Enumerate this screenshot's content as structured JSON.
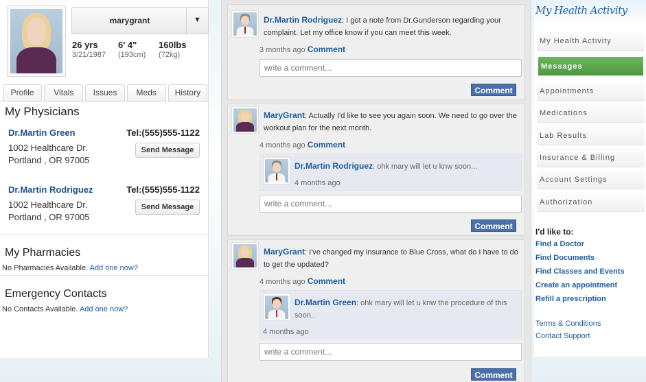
{
  "profile": {
    "username": "marygrant",
    "stats": [
      {
        "big": "26 yrs",
        "small": "3/21/1987"
      },
      {
        "big": "6' 4\"",
        "small": "(193cm)"
      },
      {
        "big": "160lbs",
        "small": "(72kg)"
      }
    ],
    "tabs": [
      "Profile",
      "Vitals",
      "Issues",
      "Meds",
      "History"
    ]
  },
  "physicians": {
    "title": "My Physicians",
    "items": [
      {
        "name": "Dr.Martin Green",
        "tel": "Tel:(555)555-1122",
        "addr1": "1002 Healthcare Dr.",
        "addr2": "Portland , OR 97005",
        "button": "Send Message"
      },
      {
        "name": "Dr.Martin Rodriguez",
        "tel": "Tel:(555)555-1122",
        "addr1": "1002 Healthcare Dr.",
        "addr2": "Portland , OR 97005",
        "button": "Send Message"
      }
    ]
  },
  "pharmacies": {
    "title": "My Pharmacies",
    "note": "No Pharmacies Available.",
    "link": "Add one now?"
  },
  "contacts": {
    "title": "Emergency Contacts",
    "note": "No Contacts Available.",
    "link": "Add one now?"
  },
  "feed": {
    "placeholder": "write a comment...",
    "comment_label": "Comment",
    "posts": [
      {
        "author": "Dr.Martin Rodriguez",
        "text": ": I got a note from Dr.Gunderson regarding your complaint. Let my office know if you can meet this week.",
        "time": "3 months ago"
      },
      {
        "author": "MaryGrant",
        "text": ": Actually I'd like to see you again soon. We need to go over the workout plan for the next month.",
        "time": "4 months ago",
        "reply": {
          "author": "Dr.Martin Rodriguez",
          "text": ": ohk mary will let u knw soon...",
          "time": "4 months ago"
        }
      },
      {
        "author": "MaryGrant",
        "text": ": I've changed my insurance to Blue Cross, what do I have to do to get the updated?",
        "time": "4 months ago",
        "reply": {
          "author": "Dr.Martin Green",
          "text": ": ohk mary will let u knw the procedure of this soon..",
          "time": "4 months ago"
        }
      }
    ]
  },
  "sidebar": {
    "logo": "My Health Activity",
    "nav": [
      "My Health Activity",
      "Messages",
      "Appointments",
      "Medications",
      "Lab Results",
      "Insurance & Billing",
      "Account Settings",
      "Authorization"
    ],
    "like_title": "I'd like to:",
    "like_links": [
      "Find a Doctor",
      "Find Documents",
      "Find Classes and Events",
      "Create an appointment",
      "Refill a prescription"
    ],
    "footer_links": [
      "Terms & Conditions",
      "Contact Support"
    ]
  }
}
